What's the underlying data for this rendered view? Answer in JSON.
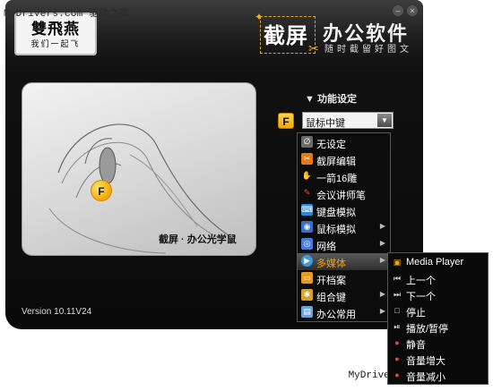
{
  "watermark_top": "MyDrivers.com 驱动之家",
  "watermark_bottom": "MyDrivers",
  "window": {
    "logo_mark": "雙飛燕",
    "logo_slogan": "我们一起飞",
    "brand_primary": "截屏",
    "brand_secondary": "办公软件",
    "brand_tagline": "随时截留好图文",
    "version": "Version 10.11V24"
  },
  "panel": {
    "caption": "截屏 · 办公光学鼠",
    "f_badge": "F"
  },
  "settings": {
    "title": "▼ 功能设定",
    "f_key": "F",
    "selected_value": "鼠标中键"
  },
  "menu": {
    "items": [
      {
        "label": "无设定",
        "icon": "none-icon",
        "color": "#6b6b6b",
        "has_submenu": false
      },
      {
        "label": "截屏编辑",
        "icon": "screenshot-edit-icon",
        "color": "#e07a1a",
        "has_submenu": false
      },
      {
        "label": "一箭16雕",
        "icon": "hand-icon",
        "color": "#cccccc",
        "has_submenu": false
      },
      {
        "label": "会议讲师笔",
        "icon": "pen-icon",
        "color": "#c8302a",
        "has_submenu": false
      },
      {
        "label": "键盘模拟",
        "icon": "keyboard-icon",
        "color": "#2a8ad8",
        "has_submenu": false
      },
      {
        "label": "鼠标模拟",
        "icon": "mouse-icon",
        "color": "#3a6fc6",
        "has_submenu": true
      },
      {
        "label": "网络",
        "icon": "network-icon",
        "color": "#4b7bd6",
        "has_submenu": true
      },
      {
        "label": "多媒体",
        "icon": "media-icon",
        "color": "#3d9ad8",
        "has_submenu": true,
        "active": true
      },
      {
        "label": "开档案",
        "icon": "folder-icon",
        "color": "#e39a27",
        "has_submenu": false
      },
      {
        "label": "组合键",
        "icon": "combo-key-icon",
        "color": "#d8a22a",
        "has_submenu": true
      },
      {
        "label": "办公常用",
        "icon": "office-icon",
        "color": "#6fa3d8",
        "has_submenu": true
      }
    ]
  },
  "submenu": {
    "items": [
      {
        "label": "Media Player",
        "icon": "media-player-icon"
      },
      {
        "label": "上一个",
        "icon": "previous-icon"
      },
      {
        "label": "下一个",
        "icon": "next-icon"
      },
      {
        "label": "停止",
        "icon": "stop-icon"
      },
      {
        "label": "播放/暂停",
        "icon": "play-pause-icon"
      },
      {
        "label": "静音",
        "icon": "mute-icon"
      },
      {
        "label": "音量增大",
        "icon": "volume-up-icon"
      },
      {
        "label": "音量减小",
        "icon": "volume-down-icon"
      }
    ]
  },
  "colors": {
    "accent": "#f2a800",
    "active_text": "#f6a300",
    "window_bg": "#0c0c0c"
  }
}
